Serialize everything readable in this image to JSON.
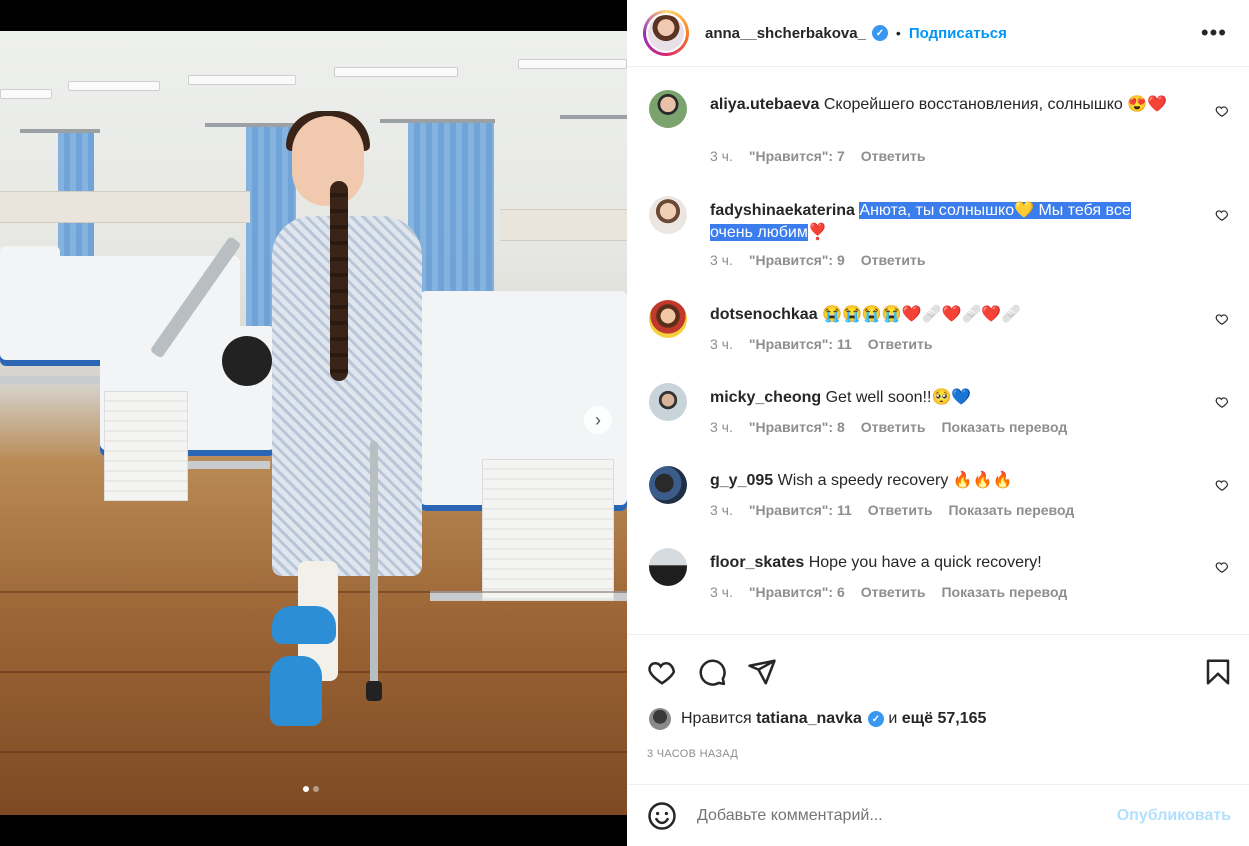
{
  "post": {
    "username": "anna__shcherbakova_",
    "separator": "•",
    "follow_label": "Подписаться",
    "more_icon": "more-options-icon",
    "more_label": "•••"
  },
  "comments": [
    {
      "user": "aliya.utebaeva",
      "text": "Скорейшего восстановления, солнышко",
      "emoji": "😍❤️",
      "time": "3 ч.",
      "likes": "\"Нравится\": 7",
      "reply": "Ответить",
      "translate": ""
    },
    {
      "user": "fadyshinaekaterina",
      "text_hl": "Анюта, ты солнышко💛  Мы тебя все очень любим",
      "emoji": "❣️",
      "time": "3 ч.",
      "likes": "\"Нравится\": 9",
      "reply": "Ответить",
      "translate": ""
    },
    {
      "user": "dotsenochkaa",
      "text": "",
      "emoji": "😭😭😭😭❤️🩹❤️🩹❤️🩹",
      "time": "3 ч.",
      "likes": "\"Нравится\": 11",
      "reply": "Ответить",
      "translate": ""
    },
    {
      "user": "micky_cheong",
      "text": "Get well soon!!",
      "emoji": "🥺💙",
      "time": "3 ч.",
      "likes": "\"Нравится\": 8",
      "reply": "Ответить",
      "translate": "Показать перевод"
    },
    {
      "user": "g_y_095",
      "text": "Wish a speedy recovery",
      "emoji": "🔥🔥🔥",
      "time": "3 ч.",
      "likes": "\"Нравится\": 11",
      "reply": "Ответить",
      "translate": "Показать перевод"
    },
    {
      "user": "floor_skates",
      "text": "Hope you have a quick recovery!",
      "emoji": "",
      "time": "3 ч.",
      "likes": "\"Нравится\": 6",
      "reply": "Ответить",
      "translate": "Показать перевод"
    }
  ],
  "likes": {
    "prefix": "Нравится",
    "user": "tatiana_navka",
    "and": "и",
    "others": "ещё 57,165"
  },
  "timestamp": "3 ЧАСОВ НАЗАД",
  "add_comment": {
    "placeholder": "Добавьте комментарий...",
    "post_label": "Опубликовать"
  },
  "colors": {
    "accent": "#0095f6",
    "highlight": "#3b7ded",
    "muted": "#8e8e8e"
  }
}
